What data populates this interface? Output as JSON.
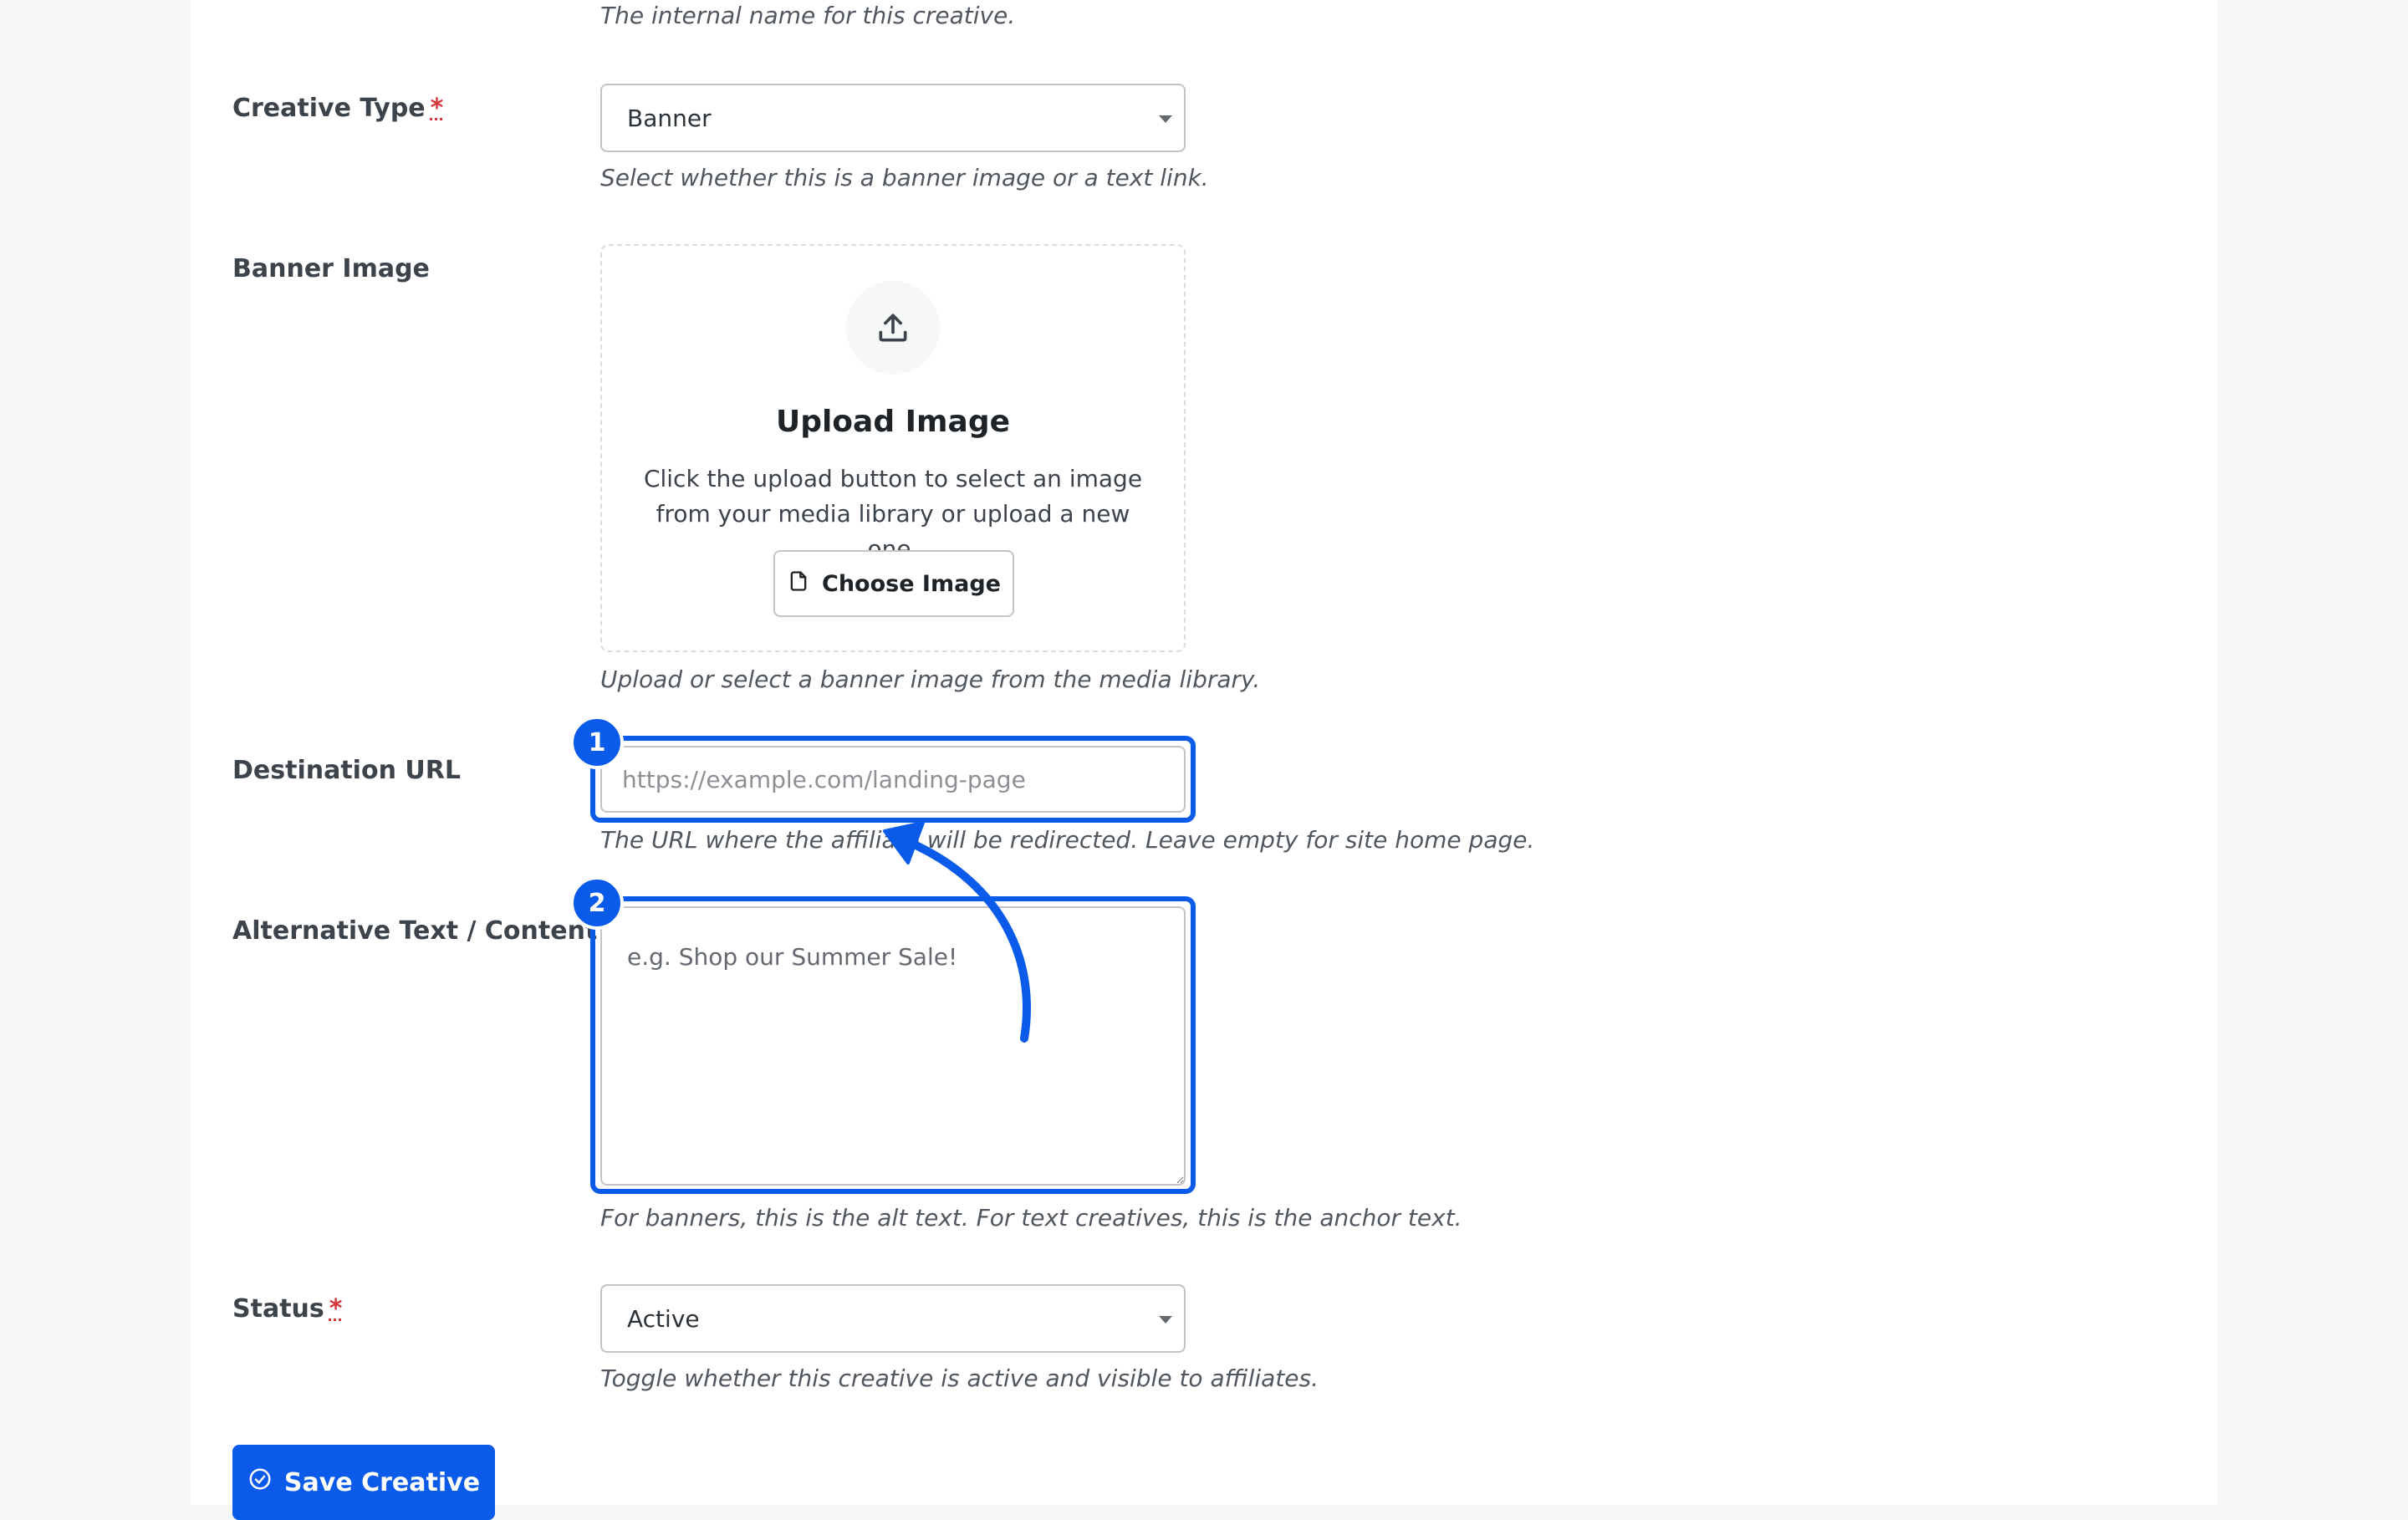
{
  "name_field": {
    "help": "The internal name for this creative."
  },
  "creative_type": {
    "label": "Creative Type",
    "required_mark": "*",
    "value": "Banner",
    "help": "Select whether this is a banner image or a text link."
  },
  "banner_image": {
    "label": "Banner Image",
    "title": "Upload Image",
    "desc_line1": "Click the upload button to select an image",
    "desc_line2": "from your media library or upload a new one.",
    "button_label": "Choose Image",
    "help": "Upload or select a banner image from the media library.",
    "icon": "upload-icon",
    "button_icon": "file-icon"
  },
  "destination_url": {
    "label": "Destination URL",
    "placeholder": "https://example.com/landing-page",
    "value": "",
    "help": "The URL where the affiliate will be redirected. Leave empty for site home page."
  },
  "alt_text": {
    "label": "Alternative Text / Content",
    "placeholder": "e.g. Shop our Summer Sale!",
    "value": "",
    "help": "For banners, this is the alt text. For text creatives, this is the anchor text."
  },
  "status": {
    "label": "Status",
    "required_mark": "*",
    "value": "Active",
    "help": "Toggle whether this creative is active and visible to affiliates."
  },
  "save_button": {
    "label": "Save Creative",
    "icon": "check-circle-icon"
  },
  "annotations": {
    "badge_1": "1",
    "badge_2": "2",
    "accent_color": "#0a5bea"
  },
  "colors": {
    "primary": "#0a5bea",
    "required": "#d63638",
    "background": "#f6f7f9"
  }
}
